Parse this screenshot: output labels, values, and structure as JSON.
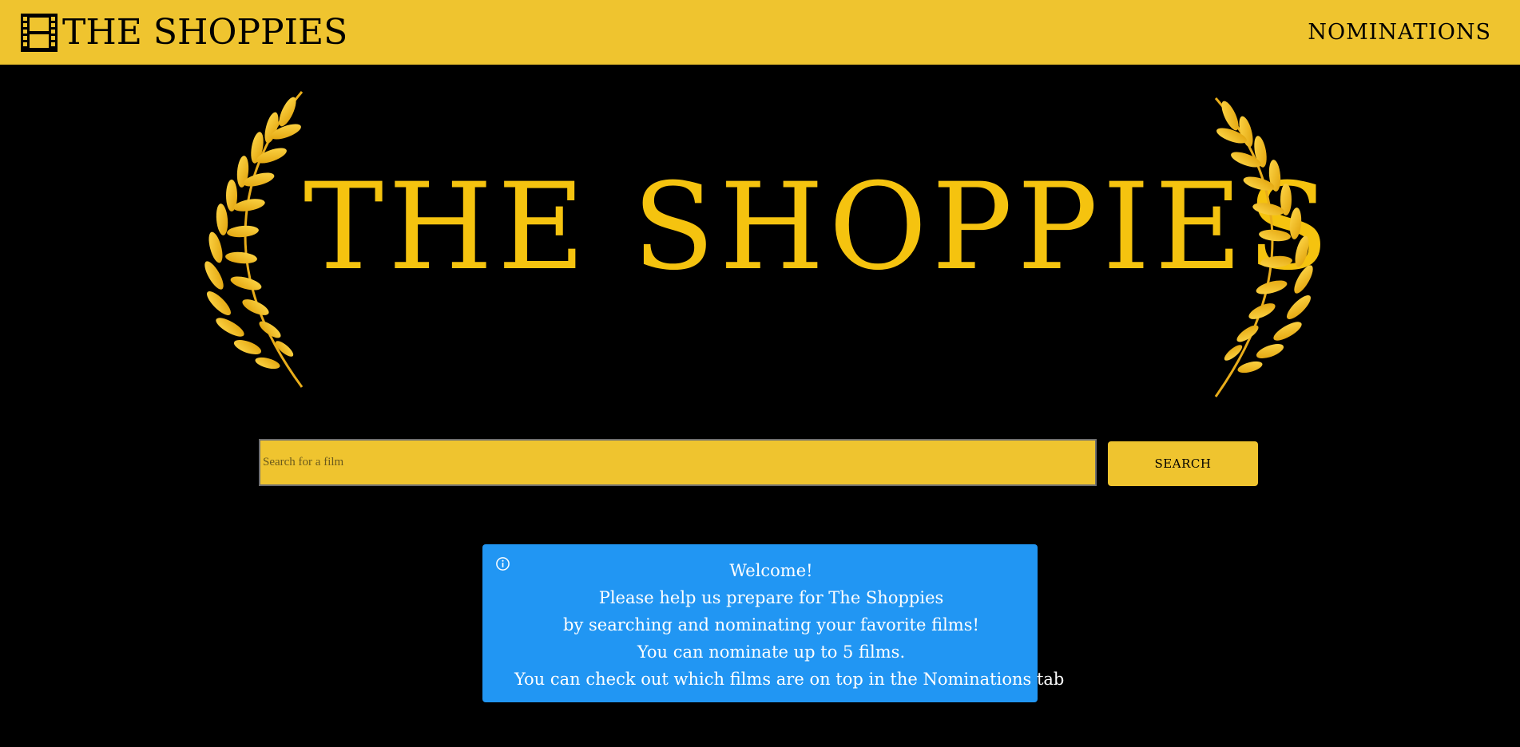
{
  "navbar": {
    "brand_text": "THE SHOPPIES",
    "brand_icon": "film-strip-icon",
    "nominations_link": "NOMINATIONS",
    "background_color": "#efc42f"
  },
  "hero": {
    "title": "THE SHOPPIES",
    "laurel_icon": "laurel-wreath-icon",
    "title_color": "#f5c30f"
  },
  "search": {
    "placeholder": "Search for a film",
    "value": "",
    "button_label": "SEARCH"
  },
  "welcome": {
    "icon": "info-icon",
    "background_color": "#2196f3",
    "lines": [
      "Welcome!",
      "Please help us prepare for The Shoppies",
      "by searching and nominating your favorite films!",
      "You can nominate up to 5 films.",
      "You can check out which films are on top in the Nominations tab"
    ]
  }
}
